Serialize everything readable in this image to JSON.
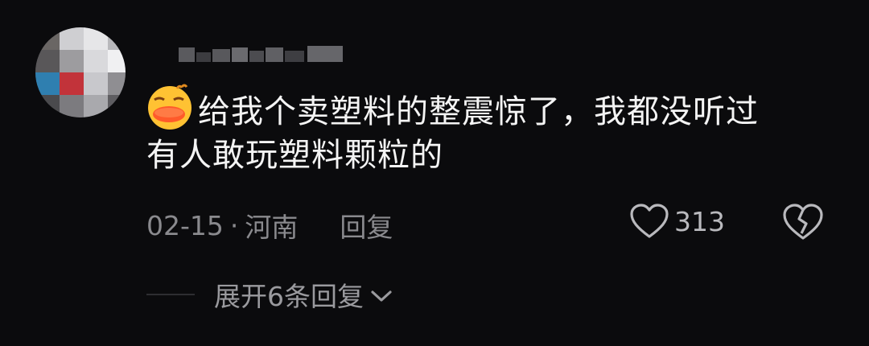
{
  "comment": {
    "emoji_icon": "duck-emoji-icon",
    "text_line1": "给我个卖塑料的整震惊了，我都没听过",
    "text_line2": "有人敢玩塑料颗粒的",
    "date": "02-15",
    "separator": "·",
    "location": "河南",
    "reply_label": "回复",
    "like_count": "313",
    "like_icon": "heart-outline-icon",
    "dislike_icon": "broken-heart-icon"
  },
  "replies": {
    "expand_label": "展开6条回复",
    "chevron_icon": "chevron-down-icon"
  },
  "colors": {
    "background": "#0b0b0d",
    "text": "#f4f4f4",
    "muted": "#8a8a8e"
  }
}
